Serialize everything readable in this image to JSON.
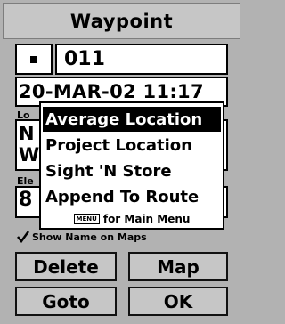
{
  "title": "Waypoint",
  "waypoint": {
    "symbol_icon": "dot-icon",
    "name": "011",
    "datetime": "20-MAR-02 11:17"
  },
  "location": {
    "label": "Lo",
    "line1": "N",
    "line2": "W"
  },
  "elevation": {
    "label": "Ele",
    "value": "8"
  },
  "popup_menu": {
    "items": [
      {
        "label": "Average Location",
        "selected": true
      },
      {
        "label": "Project Location",
        "selected": false
      },
      {
        "label": "Sight 'N Store",
        "selected": false
      },
      {
        "label": "Append To Route",
        "selected": false
      }
    ],
    "menu_key": "MENU",
    "main_menu_hint": "for Main Menu"
  },
  "show_name": {
    "checked": true,
    "label": "Show Name on Maps"
  },
  "buttons": {
    "delete": "Delete",
    "map": "Map",
    "goto": "Goto",
    "ok": "OK"
  }
}
